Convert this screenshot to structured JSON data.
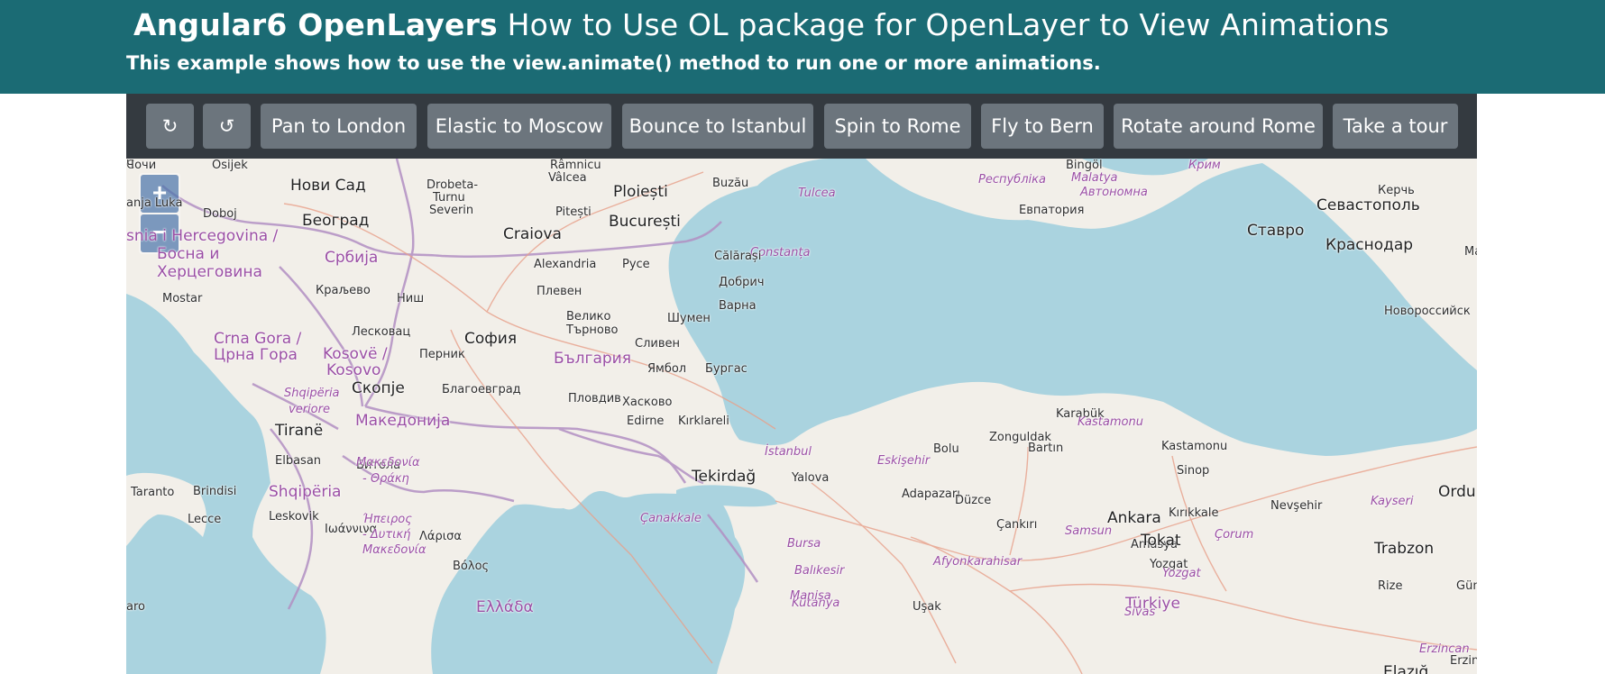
{
  "header": {
    "title_strong": "Angular6 OpenLayers",
    "title_rest": " How to Use OL package for OpenLayer to View Animations",
    "subtitle": "This example shows how to use the view.animate() method to run one or more animations."
  },
  "toolbar": {
    "buttons": [
      {
        "label": "↻",
        "icon": "rotate-clockwise-icon"
      },
      {
        "label": "↺",
        "icon": "rotate-counterclockwise-icon"
      },
      {
        "label": "Pan to London"
      },
      {
        "label": "Elastic to Moscow"
      },
      {
        "label": "Bounce to Istanbul"
      },
      {
        "label": "Spin to Rome"
      },
      {
        "label": "Fly to Bern"
      },
      {
        "label": "Rotate around Rome"
      },
      {
        "label": "Take a tour"
      }
    ]
  },
  "map": {
    "zoom_in": "+",
    "zoom_out": "−",
    "colors": {
      "land": "#f2efe9",
      "water": "#aad3df",
      "border": "#b28fc3",
      "road": "#e8a08a"
    },
    "labels": [
      {
        "t": "Osijek",
        "c": "city"
      },
      {
        "t": "Нови Сад",
        "c": "city big"
      },
      {
        "t": "Doboj",
        "c": "city"
      },
      {
        "t": "Београд",
        "c": "city big"
      },
      {
        "t": "anja Luka",
        "c": "city"
      },
      {
        "t": "snia i Hercegovina /",
        "c": "country"
      },
      {
        "t": "Босна и",
        "c": "country"
      },
      {
        "t": "Херцеговина",
        "c": "country"
      },
      {
        "t": "Србија",
        "c": "country"
      },
      {
        "t": "Краљево",
        "c": "city"
      },
      {
        "t": "Ниш",
        "c": "city"
      },
      {
        "t": "Mostar",
        "c": "city"
      },
      {
        "t": "Crna Gora /",
        "c": "country"
      },
      {
        "t": "Црна Гора",
        "c": "country"
      },
      {
        "t": "Лесковац",
        "c": "city"
      },
      {
        "t": "Kosovë /",
        "c": "country"
      },
      {
        "t": "Kosovo",
        "c": "country"
      },
      {
        "t": "Shqipëria",
        "c": "region"
      },
      {
        "t": "veriore",
        "c": "region"
      },
      {
        "t": "Скопје",
        "c": "city big"
      },
      {
        "t": "Македонија",
        "c": "country"
      },
      {
        "t": "Tiranë",
        "c": "city big"
      },
      {
        "t": "Elbasan",
        "c": "city"
      },
      {
        "t": "Битола",
        "c": "city"
      },
      {
        "t": "Shqipëria",
        "c": "country"
      },
      {
        "t": "Taranto",
        "c": "city"
      },
      {
        "t": "Brindisi",
        "c": "city"
      },
      {
        "t": "Lecce",
        "c": "city"
      },
      {
        "t": "Leskovik",
        "c": "city"
      },
      {
        "t": "Ιωάννινα",
        "c": "city"
      },
      {
        "t": "aro",
        "c": "city"
      },
      {
        "t": "Ήπειρος",
        "c": "region"
      },
      {
        "t": "- Δυτική",
        "c": "region"
      },
      {
        "t": "Μακεδονία",
        "c": "region"
      },
      {
        "t": "Μακεδονία",
        "c": "region"
      },
      {
        "t": "- Θράκη",
        "c": "region"
      },
      {
        "t": "Λάρισα",
        "c": "city"
      },
      {
        "t": "Βόλος",
        "c": "city"
      },
      {
        "t": "Ελλάδα",
        "c": "country"
      },
      {
        "t": "Râmnicu",
        "c": "city"
      },
      {
        "t": "Vâlcea",
        "c": "city"
      },
      {
        "t": "Drobeta-",
        "c": "city"
      },
      {
        "t": "Turnu",
        "c": "city"
      },
      {
        "t": "Severin",
        "c": "city"
      },
      {
        "t": "Ploiești",
        "c": "city big"
      },
      {
        "t": "Buzău",
        "c": "city"
      },
      {
        "t": "Pitești",
        "c": "city"
      },
      {
        "t": "București",
        "c": "city big"
      },
      {
        "t": "Craiova",
        "c": "city big"
      },
      {
        "t": "Tulcea",
        "c": "region"
      },
      {
        "t": "Constanța",
        "c": "region"
      },
      {
        "t": "Călărași",
        "c": "city"
      },
      {
        "t": "Alexandria",
        "c": "city"
      },
      {
        "t": "Русе",
        "c": "city"
      },
      {
        "t": "Добрич",
        "c": "city"
      },
      {
        "t": "Плевен",
        "c": "city"
      },
      {
        "t": "Варна",
        "c": "city"
      },
      {
        "t": "Велико",
        "c": "city"
      },
      {
        "t": "Търново",
        "c": "city"
      },
      {
        "t": "Шумен",
        "c": "city"
      },
      {
        "t": "София",
        "c": "city big"
      },
      {
        "t": "Перник",
        "c": "city"
      },
      {
        "t": "Сливен",
        "c": "city"
      },
      {
        "t": "България",
        "c": "country"
      },
      {
        "t": "Ямбол",
        "c": "city"
      },
      {
        "t": "Бургас",
        "c": "city"
      },
      {
        "t": "Благоевград",
        "c": "city"
      },
      {
        "t": "Пловдив",
        "c": "city"
      },
      {
        "t": "Хасково",
        "c": "city"
      },
      {
        "t": "Edirne",
        "c": "city"
      },
      {
        "t": "Kırklareli",
        "c": "city"
      },
      {
        "t": "İstanbul",
        "c": "region"
      },
      {
        "t": "Tekirdağ",
        "c": "city big"
      },
      {
        "t": "Çanakkale",
        "c": "region"
      },
      {
        "t": "Yalova",
        "c": "city"
      },
      {
        "t": "Bursa",
        "c": "region"
      },
      {
        "t": "Balıkesir",
        "c": "region"
      },
      {
        "t": "Kütahya",
        "c": "region"
      },
      {
        "t": "Manisa",
        "c": "region"
      },
      {
        "t": "Uşak",
        "c": "city"
      },
      {
        "t": "Afyonkarahisar",
        "c": "region"
      },
      {
        "t": "Eskişehir",
        "c": "region"
      },
      {
        "t": "Adapazarı",
        "c": "city"
      },
      {
        "t": "Düzce",
        "c": "city"
      },
      {
        "t": "Bolu",
        "c": "city"
      },
      {
        "t": "Zonguldak",
        "c": "city"
      },
      {
        "t": "Bartın",
        "c": "city"
      },
      {
        "t": "Karabük",
        "c": "city"
      },
      {
        "t": "Kastamonu",
        "c": "region"
      },
      {
        "t": "Kastamonu",
        "c": "city"
      },
      {
        "t": "Sinop",
        "c": "city"
      },
      {
        "t": "Samsun",
        "c": "region"
      },
      {
        "t": "Çankırı",
        "c": "city"
      },
      {
        "t": "Ankara",
        "c": "city big"
      },
      {
        "t": "Kırıkkale",
        "c": "city"
      },
      {
        "t": "Çorum",
        "c": "region"
      },
      {
        "t": "Amasya",
        "c": "city"
      },
      {
        "t": "Tokat",
        "c": "city big"
      },
      {
        "t": "Yozgat",
        "c": "city"
      },
      {
        "t": "Yozgat",
        "c": "region"
      },
      {
        "t": "Türkiye",
        "c": "country"
      },
      {
        "t": "Sivas",
        "c": "region"
      },
      {
        "t": "Nevşehir",
        "c": "city"
      },
      {
        "t": "Kayseri",
        "c": "region"
      },
      {
        "t": "Ordu",
        "c": "city big"
      },
      {
        "t": "Trabzon",
        "c": "city big"
      },
      {
        "t": "Rize",
        "c": "city"
      },
      {
        "t": "Gümüşhane",
        "c": "city"
      },
      {
        "t": "Erzincan",
        "c": "region"
      },
      {
        "t": "Erzincan",
        "c": "city"
      },
      {
        "t": "Elazığ",
        "c": "city big"
      },
      {
        "t": "Bingöl",
        "c": "city"
      },
      {
        "t": "Malatya",
        "c": "region"
      },
      {
        "t": "Автономна",
        "c": "region"
      },
      {
        "t": "Республіка",
        "c": "region"
      },
      {
        "t": "Крим",
        "c": "region"
      },
      {
        "t": "Евпатория",
        "c": "city"
      },
      {
        "t": "Керчь",
        "c": "city"
      },
      {
        "t": "Севастополь",
        "c": "city big"
      },
      {
        "t": "Ставро",
        "c": "city big"
      },
      {
        "t": "Краснодар",
        "c": "city big"
      },
      {
        "t": "Новороссийск",
        "c": "city"
      },
      {
        "t": "Майкоп",
        "c": "city"
      },
      {
        "t": "Сочи",
        "c": "city"
      },
      {
        "t": "Ч",
        "c": "city"
      }
    ]
  }
}
